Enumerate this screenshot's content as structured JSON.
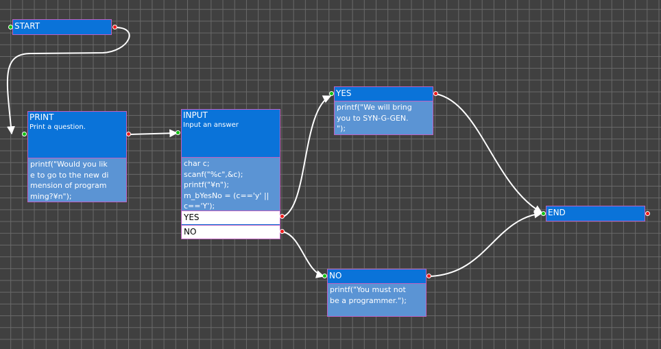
{
  "nodes": {
    "start": {
      "title": "START"
    },
    "print": {
      "title": "PRINT",
      "subtitle": "Print a question.",
      "code": [
        "printf(\"Would you lik",
        "e to go to the new di",
        "mension of program",
        "ming?¥n\");"
      ]
    },
    "input": {
      "title": "INPUT",
      "subtitle": "Input an answer",
      "code": [
        "char c;",
        "scanf(\"%c\",&c);",
        "printf(\"¥n\");",
        "m_bYesNo = (c=='y' ||",
        "c=='Y');"
      ],
      "choices": [
        "YES",
        "NO"
      ]
    },
    "yes": {
      "title": "YES",
      "code": [
        "printf(\"We will bring",
        "you to SYN-G-GEN.",
        "\");"
      ]
    },
    "no": {
      "title": "NO",
      "code": [
        "printf(\"You must not",
        "be a programmer.\");"
      ]
    },
    "end": {
      "title": "END"
    }
  },
  "colors": {
    "background": "#404040",
    "grid": "#6a6a6a",
    "node_header": "#0a73d9",
    "node_body": "#5b94d4",
    "node_border": "#c060c0",
    "choice_bg": "#ffffff",
    "port_in": "#12c012",
    "port_out": "#ee1b1b",
    "edge": "#ffffff"
  },
  "edges": [
    {
      "from": "start",
      "to": "print"
    },
    {
      "from": "print",
      "to": "input"
    },
    {
      "from": "input.yes",
      "to": "yes"
    },
    {
      "from": "input.no",
      "to": "no"
    },
    {
      "from": "yes",
      "to": "end"
    },
    {
      "from": "no",
      "to": "end"
    }
  ]
}
